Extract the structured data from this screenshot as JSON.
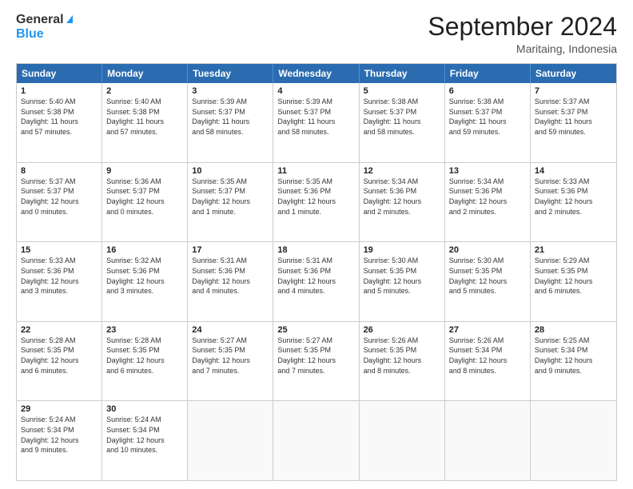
{
  "header": {
    "logo_line1": "General",
    "logo_line2": "Blue",
    "month_title": "September 2024",
    "subtitle": "Maritaing, Indonesia"
  },
  "calendar": {
    "weekdays": [
      "Sunday",
      "Monday",
      "Tuesday",
      "Wednesday",
      "Thursday",
      "Friday",
      "Saturday"
    ],
    "rows": [
      [
        {
          "day": "1",
          "lines": [
            "Sunrise: 5:40 AM",
            "Sunset: 5:38 PM",
            "Daylight: 11 hours",
            "and 57 minutes."
          ]
        },
        {
          "day": "2",
          "lines": [
            "Sunrise: 5:40 AM",
            "Sunset: 5:38 PM",
            "Daylight: 11 hours",
            "and 57 minutes."
          ]
        },
        {
          "day": "3",
          "lines": [
            "Sunrise: 5:39 AM",
            "Sunset: 5:37 PM",
            "Daylight: 11 hours",
            "and 58 minutes."
          ]
        },
        {
          "day": "4",
          "lines": [
            "Sunrise: 5:39 AM",
            "Sunset: 5:37 PM",
            "Daylight: 11 hours",
            "and 58 minutes."
          ]
        },
        {
          "day": "5",
          "lines": [
            "Sunrise: 5:38 AM",
            "Sunset: 5:37 PM",
            "Daylight: 11 hours",
            "and 58 minutes."
          ]
        },
        {
          "day": "6",
          "lines": [
            "Sunrise: 5:38 AM",
            "Sunset: 5:37 PM",
            "Daylight: 11 hours",
            "and 59 minutes."
          ]
        },
        {
          "day": "7",
          "lines": [
            "Sunrise: 5:37 AM",
            "Sunset: 5:37 PM",
            "Daylight: 11 hours",
            "and 59 minutes."
          ]
        }
      ],
      [
        {
          "day": "8",
          "lines": [
            "Sunrise: 5:37 AM",
            "Sunset: 5:37 PM",
            "Daylight: 12 hours",
            "and 0 minutes."
          ]
        },
        {
          "day": "9",
          "lines": [
            "Sunrise: 5:36 AM",
            "Sunset: 5:37 PM",
            "Daylight: 12 hours",
            "and 0 minutes."
          ]
        },
        {
          "day": "10",
          "lines": [
            "Sunrise: 5:35 AM",
            "Sunset: 5:37 PM",
            "Daylight: 12 hours",
            "and 1 minute."
          ]
        },
        {
          "day": "11",
          "lines": [
            "Sunrise: 5:35 AM",
            "Sunset: 5:36 PM",
            "Daylight: 12 hours",
            "and 1 minute."
          ]
        },
        {
          "day": "12",
          "lines": [
            "Sunrise: 5:34 AM",
            "Sunset: 5:36 PM",
            "Daylight: 12 hours",
            "and 2 minutes."
          ]
        },
        {
          "day": "13",
          "lines": [
            "Sunrise: 5:34 AM",
            "Sunset: 5:36 PM",
            "Daylight: 12 hours",
            "and 2 minutes."
          ]
        },
        {
          "day": "14",
          "lines": [
            "Sunrise: 5:33 AM",
            "Sunset: 5:36 PM",
            "Daylight: 12 hours",
            "and 2 minutes."
          ]
        }
      ],
      [
        {
          "day": "15",
          "lines": [
            "Sunrise: 5:33 AM",
            "Sunset: 5:36 PM",
            "Daylight: 12 hours",
            "and 3 minutes."
          ]
        },
        {
          "day": "16",
          "lines": [
            "Sunrise: 5:32 AM",
            "Sunset: 5:36 PM",
            "Daylight: 12 hours",
            "and 3 minutes."
          ]
        },
        {
          "day": "17",
          "lines": [
            "Sunrise: 5:31 AM",
            "Sunset: 5:36 PM",
            "Daylight: 12 hours",
            "and 4 minutes."
          ]
        },
        {
          "day": "18",
          "lines": [
            "Sunrise: 5:31 AM",
            "Sunset: 5:36 PM",
            "Daylight: 12 hours",
            "and 4 minutes."
          ]
        },
        {
          "day": "19",
          "lines": [
            "Sunrise: 5:30 AM",
            "Sunset: 5:35 PM",
            "Daylight: 12 hours",
            "and 5 minutes."
          ]
        },
        {
          "day": "20",
          "lines": [
            "Sunrise: 5:30 AM",
            "Sunset: 5:35 PM",
            "Daylight: 12 hours",
            "and 5 minutes."
          ]
        },
        {
          "day": "21",
          "lines": [
            "Sunrise: 5:29 AM",
            "Sunset: 5:35 PM",
            "Daylight: 12 hours",
            "and 6 minutes."
          ]
        }
      ],
      [
        {
          "day": "22",
          "lines": [
            "Sunrise: 5:28 AM",
            "Sunset: 5:35 PM",
            "Daylight: 12 hours",
            "and 6 minutes."
          ]
        },
        {
          "day": "23",
          "lines": [
            "Sunrise: 5:28 AM",
            "Sunset: 5:35 PM",
            "Daylight: 12 hours",
            "and 6 minutes."
          ]
        },
        {
          "day": "24",
          "lines": [
            "Sunrise: 5:27 AM",
            "Sunset: 5:35 PM",
            "Daylight: 12 hours",
            "and 7 minutes."
          ]
        },
        {
          "day": "25",
          "lines": [
            "Sunrise: 5:27 AM",
            "Sunset: 5:35 PM",
            "Daylight: 12 hours",
            "and 7 minutes."
          ]
        },
        {
          "day": "26",
          "lines": [
            "Sunrise: 5:26 AM",
            "Sunset: 5:35 PM",
            "Daylight: 12 hours",
            "and 8 minutes."
          ]
        },
        {
          "day": "27",
          "lines": [
            "Sunrise: 5:26 AM",
            "Sunset: 5:34 PM",
            "Daylight: 12 hours",
            "and 8 minutes."
          ]
        },
        {
          "day": "28",
          "lines": [
            "Sunrise: 5:25 AM",
            "Sunset: 5:34 PM",
            "Daylight: 12 hours",
            "and 9 minutes."
          ]
        }
      ],
      [
        {
          "day": "29",
          "lines": [
            "Sunrise: 5:24 AM",
            "Sunset: 5:34 PM",
            "Daylight: 12 hours",
            "and 9 minutes."
          ]
        },
        {
          "day": "30",
          "lines": [
            "Sunrise: 5:24 AM",
            "Sunset: 5:34 PM",
            "Daylight: 12 hours",
            "and 10 minutes."
          ]
        },
        {
          "day": "",
          "lines": []
        },
        {
          "day": "",
          "lines": []
        },
        {
          "day": "",
          "lines": []
        },
        {
          "day": "",
          "lines": []
        },
        {
          "day": "",
          "lines": []
        }
      ]
    ]
  }
}
